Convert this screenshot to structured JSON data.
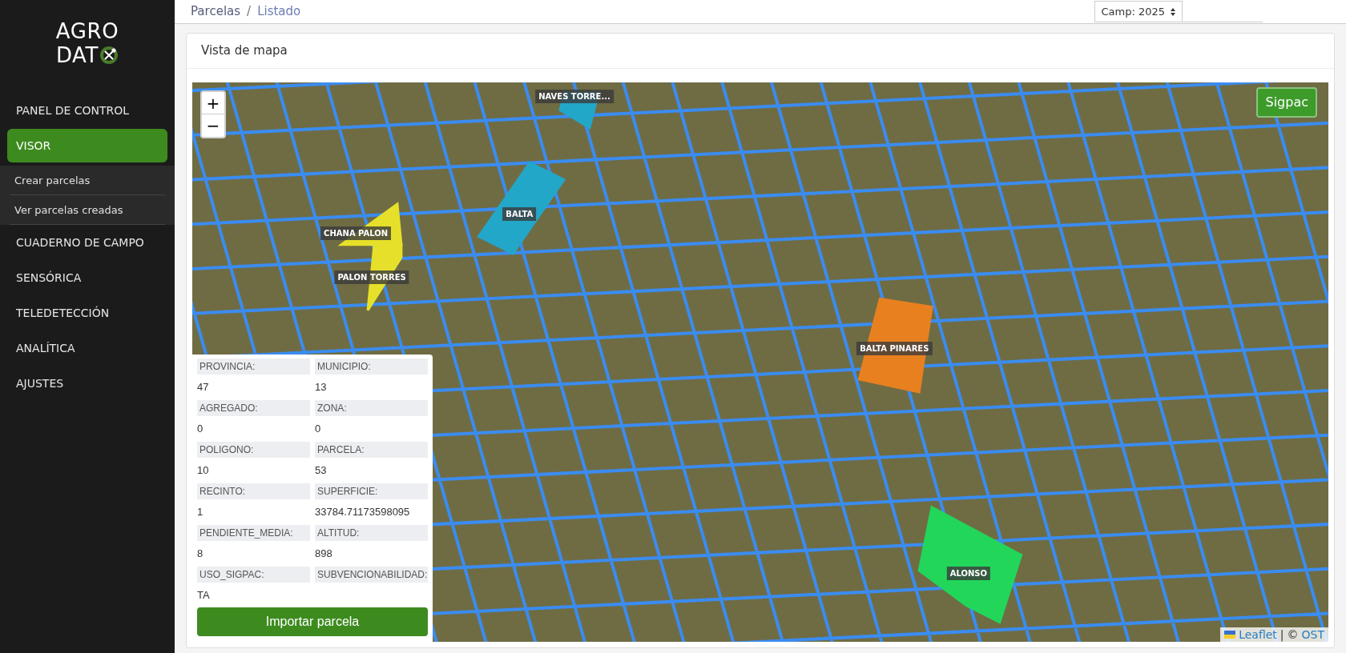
{
  "sidebar": {
    "logo": {
      "line_1": "AGRO",
      "line_2": "DAT"
    },
    "items": [
      {
        "label": "PANEL DE CONTROL",
        "selected": false
      },
      {
        "label": "VISOR",
        "selected": true,
        "children": [
          {
            "label": "Crear parcelas"
          },
          {
            "label": "Ver parcelas creadas"
          }
        ]
      },
      {
        "label": "CUADERNO DE CAMPO",
        "selected": false
      },
      {
        "label": "SENSÓRICA",
        "selected": false
      },
      {
        "label": "TELEDETECCIÓN",
        "selected": false
      },
      {
        "label": "ANALÍTICA",
        "selected": false
      },
      {
        "label": "AJUSTES",
        "selected": false
      }
    ]
  },
  "breadcrumb": {
    "items": [
      "Parcelas",
      "Listado"
    ],
    "separator": "/"
  },
  "campaign_select": {
    "value": "Camp: 2025"
  },
  "card": {
    "title": "Vista de mapa"
  },
  "map": {
    "zoom_in": "+",
    "zoom_out": "−",
    "layer_button": "Sigpac",
    "parcels": [
      {
        "label": "NAVES TORRE...",
        "color": "#22a7c9"
      },
      {
        "label": "BALTA",
        "color": "#22a7c9"
      },
      {
        "label": "CHANA PALON",
        "color": "#e6e02a"
      },
      {
        "label": "PALON TORRES",
        "color": "#e6e02a"
      },
      {
        "label": "BALTA PINARES",
        "color": "#e8801f"
      },
      {
        "label": "ALONSO",
        "color": "#22d65a"
      }
    ],
    "attribution": {
      "link_1": "Leaflet",
      "separator": "|",
      "prefix": "©",
      "link_2": "OST"
    },
    "info_panel": {
      "fields": [
        {
          "label": "PROVINCIA:",
          "value": "47"
        },
        {
          "label": "MUNICIPIO:",
          "value": "13"
        },
        {
          "label": "AGREGADO:",
          "value": "0"
        },
        {
          "label": "ZONA:",
          "value": "0"
        },
        {
          "label": "POLIGONO:",
          "value": "10"
        },
        {
          "label": "PARCELA:",
          "value": "53"
        },
        {
          "label": "RECINTO:",
          "value": "1"
        },
        {
          "label": "SUPERFICIE:",
          "value": "33784.71173598095"
        },
        {
          "label": "PENDIENTE_MEDIA:",
          "value": "8"
        },
        {
          "label": "ALTITUD:",
          "value": "898"
        },
        {
          "label": "USO_SIGPAC:",
          "value": "TA"
        },
        {
          "label": "SUBVENCIONABILIDAD:"
        }
      ],
      "button": "Importar parcela"
    }
  }
}
